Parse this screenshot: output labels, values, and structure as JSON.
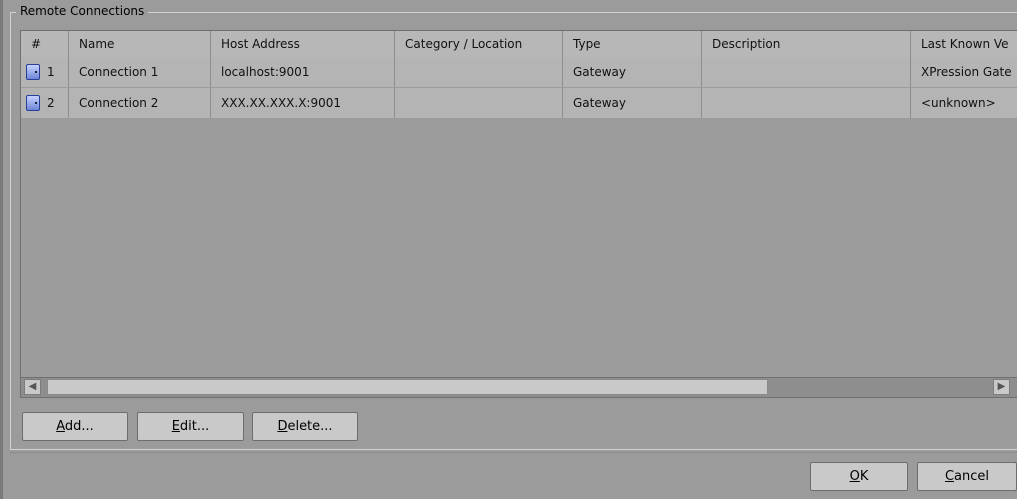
{
  "groupbox": {
    "title": "Remote Connections"
  },
  "table": {
    "headers": [
      "#",
      "Name",
      "Host Address",
      "Category / Location",
      "Type",
      "Description",
      "Last Known Ve"
    ],
    "rows": [
      {
        "num": "1",
        "name": "Connection 1",
        "host": "localhost:9001",
        "category": "",
        "type": "Gateway",
        "description": "",
        "last_known": "XPression Gate"
      },
      {
        "num": "2",
        "name": "Connection 2",
        "host": "XXX.XX.XXX.X:9001",
        "category": "",
        "type": "Gateway",
        "description": "",
        "last_known": "<unknown>"
      }
    ],
    "row_icon": "connection-icon"
  },
  "scrollbar": {
    "left_icon": "scroll-left-icon",
    "right_icon": "scroll-right-icon",
    "left_glyph": "◀",
    "right_glyph": "▶"
  },
  "buttons": {
    "add": {
      "mnemonic": "A",
      "rest": "dd..."
    },
    "edit": {
      "mnemonic": "E",
      "rest": "dit..."
    },
    "delete": {
      "mnemonic": "D",
      "rest": "elete..."
    },
    "ok": {
      "mnemonic": "O",
      "rest": "K"
    },
    "cancel": {
      "mnemonic": "C",
      "rest": "ancel"
    }
  }
}
